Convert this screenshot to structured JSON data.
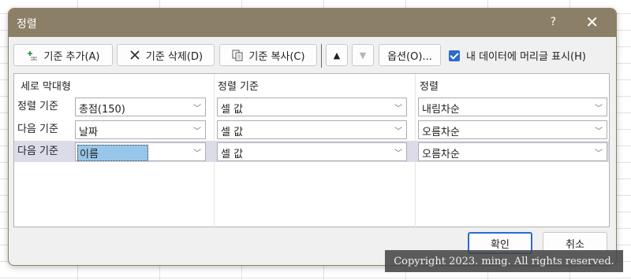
{
  "window": {
    "title": "정렬",
    "help_label": "?",
    "close_label": "✕"
  },
  "toolbar": {
    "add_level": "기준 추가(A)",
    "delete_level": "기준 삭제(D)",
    "copy_level": "기준 복사(C)",
    "move_up_glyph": "▲",
    "move_down_glyph": "▼",
    "options": "옵션(O)...",
    "header_checkbox_label": "내 데이터에 머리글 표시(H)",
    "header_checkbox_checked": true
  },
  "columns": {
    "column": "세로 막대형",
    "sort_on": "정렬 기준",
    "order": "정렬"
  },
  "rows": [
    {
      "label": "정렬 기준",
      "column": "총점(150)",
      "sort_on": "셀 값",
      "order": "내림차순",
      "selected": false
    },
    {
      "label": "다음 기준",
      "column": "날짜",
      "sort_on": "셀 값",
      "order": "오름차순",
      "selected": false
    },
    {
      "label": "다음 기준",
      "column": "이름",
      "sort_on": "셀 값",
      "order": "오름차순",
      "selected": true
    }
  ],
  "buttons": {
    "ok": "확인",
    "cancel": "취소"
  },
  "watermark": "Copyright 2023. ming. All rights reserved.",
  "colors": {
    "titlebar": "#8c7f67",
    "accent": "#2a6ad1",
    "selected_row": "#dcdce8"
  }
}
